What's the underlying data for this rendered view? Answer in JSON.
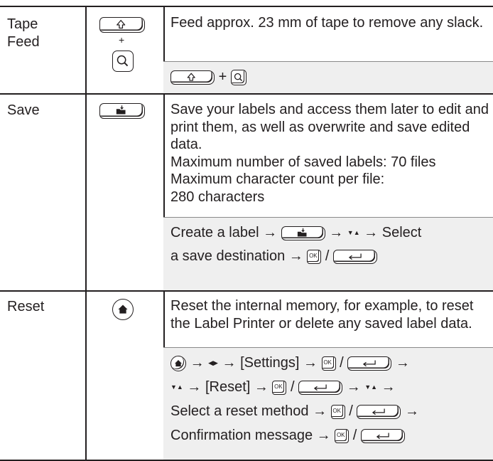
{
  "rows": [
    {
      "name": "Tape\nFeed",
      "description": "Feed approx. 23 mm of tape to remove any slack.",
      "keys": {
        "plus": "+"
      },
      "sequence": {
        "plus": "+"
      }
    },
    {
      "name": "Save",
      "description": "Save your labels and access them later to edit and print them, as well as overwrite and save edited data.\nMaximum number of saved labels: 70 files\nMaximum character count per file:\n280 characters",
      "sequence": {
        "line1_a": "Create a label",
        "line1_b": "Select",
        "line2_a": "a save destination",
        "slash": "/"
      }
    },
    {
      "name": "Reset",
      "description": "Reset the internal memory, for example, to reset the Label Printer or delete any saved label data.",
      "sequence": {
        "settings": "[Settings]",
        "reset": "[Reset]",
        "method": "Select a reset method",
        "confirm": "Confirmation message",
        "slash": "/"
      }
    }
  ],
  "symbols": {
    "arrow": "→",
    "down_up": "▼▲",
    "left_right": "◀▶",
    "ok_label": "OK"
  },
  "icons": [
    "shift-icon",
    "search-icon",
    "save-icon",
    "home-icon",
    "ok-icon",
    "enter-icon"
  ]
}
